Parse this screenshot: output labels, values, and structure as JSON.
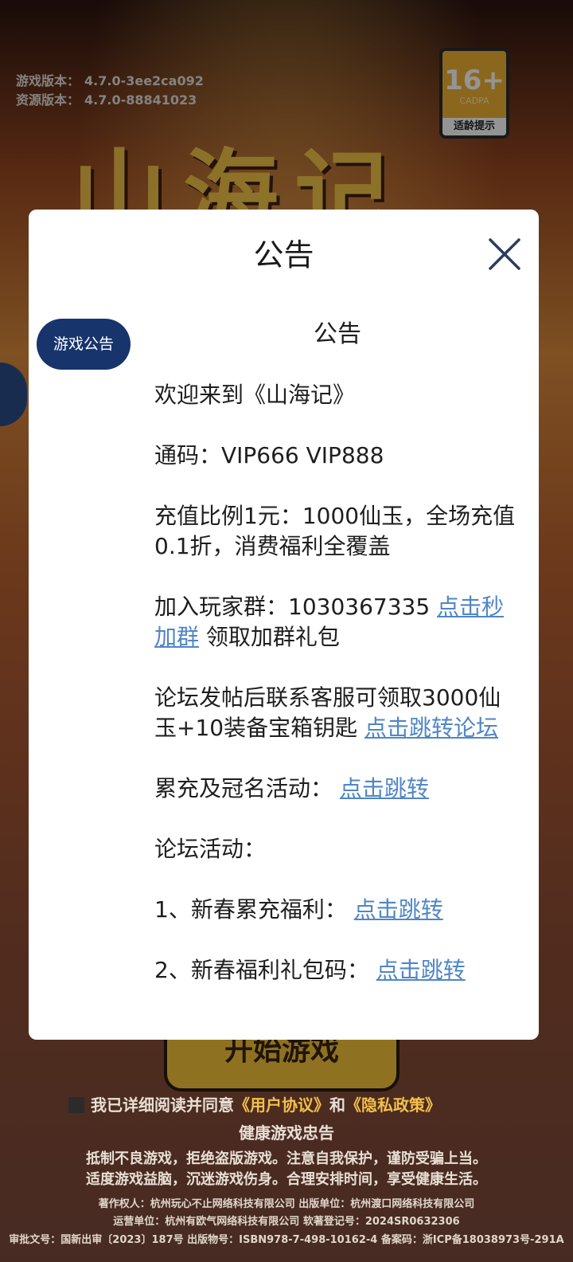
{
  "background": {
    "game_logo": "山海记",
    "version": {
      "game_label": "游戏版本：",
      "game_value": "4.7.0-3ee2ca092",
      "res_label": "资源版本：",
      "res_value": "4.7.0-88841023"
    },
    "age_rating": {
      "age": "16+",
      "org": "CADPA",
      "tip": "适龄提示"
    },
    "start_button": "开始游戏",
    "agreement": {
      "text": "我已详细阅读并同意",
      "user_agreement": "《用户协议》",
      "and": "和",
      "privacy": "《隐私政策》"
    },
    "health": {
      "title": "健康游戏忠告",
      "line1": "抵制不良游戏，拒绝盗版游戏。注意自我保护，谨防受骗上当。",
      "line2": "适度游戏益脑，沉迷游戏伤身。合理安排时间，享受健康生活。"
    },
    "credits": {
      "line1": "著作权人：杭州玩心不止网络科技有限公司  出版单位：杭州渡口网络科技有限公司",
      "line2": "运营单位：杭州有欧气网络科技有限公司  软著登记号：2024SR0632306",
      "line3": "审批文号：国新出审〔2023〕187号 出版物号：ISBN978-7-498-10162-4 备案码：浙ICP备18038973号-291A"
    }
  },
  "modal": {
    "title": "公告",
    "tab_label": "游戏公告",
    "content": {
      "heading": "公告",
      "welcome": "欢迎来到《山海记》",
      "code": "通码：VIP666 VIP888",
      "recharge": "充值比例1元：1000仙玉，全场充值0.1折，消费福利全覆盖",
      "group_text": "加入玩家群：1030367335 ",
      "group_link": "点击秒加群",
      "group_suffix": " 领取加群礼包",
      "forum_text": "论坛发帖后联系客服可领取3000仙玉+10装备宝箱钥匙 ",
      "forum_link": "点击跳转论坛",
      "recharge_event_text": "累充及冠名活动： ",
      "recharge_event_link": "点击跳转",
      "forum_events": "论坛活动：",
      "event1_text": "1、新春累充福利： ",
      "event1_link": "点击跳转",
      "event2_text": "2、新春福利礼包码： ",
      "event2_link": "点击跳转"
    }
  },
  "colors": {
    "tab_bg": "#17346c",
    "link": "#4f86c6",
    "modal_bg": "#ffffff"
  }
}
